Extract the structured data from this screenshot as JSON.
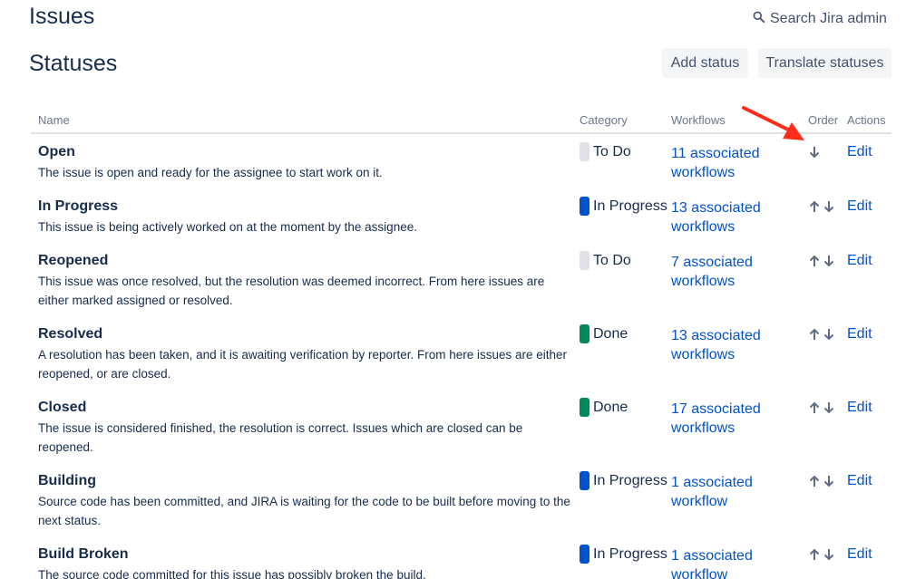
{
  "header": {
    "title": "Issues",
    "search_label": "Search Jira admin"
  },
  "section": {
    "title": "Statuses",
    "add_button": "Add status",
    "translate_button": "Translate statuses"
  },
  "table": {
    "columns": {
      "name": "Name",
      "category": "Category",
      "workflows": "Workflows",
      "order": "Order",
      "actions": "Actions"
    },
    "rows": [
      {
        "name": "Open",
        "description": "The issue is open and ready for the assignee to start work on it.",
        "category": "To Do",
        "category_color": "#dfe1e6",
        "workflows_line1": "11 associated",
        "workflows_line2": "workflows",
        "edit": "Edit"
      },
      {
        "name": "In Progress",
        "description": "This issue is being actively worked on at the moment by the assignee.",
        "category": "In Progress",
        "category_color": "#0052cc",
        "workflows_line1": "13 associated",
        "workflows_line2": "workflows",
        "edit": "Edit"
      },
      {
        "name": "Reopened",
        "description": "This issue was once resolved, but the resolution was deemed incorrect. From here issues are either marked assigned or resolved.",
        "category": "To Do",
        "category_color": "#dfe1e6",
        "workflows_line1": "7 associated",
        "workflows_line2": "workflows",
        "edit": "Edit"
      },
      {
        "name": "Resolved",
        "description": "A resolution has been taken, and it is awaiting verification by reporter. From here issues are either reopened, or are closed.",
        "category": "Done",
        "category_color": "#00875a",
        "workflows_line1": "13 associated",
        "workflows_line2": "workflows",
        "edit": "Edit"
      },
      {
        "name": "Closed",
        "description": "The issue is considered finished, the resolution is correct. Issues which are closed can be reopened.",
        "category": "Done",
        "category_color": "#00875a",
        "workflows_line1": "17 associated",
        "workflows_line2": "workflows",
        "edit": "Edit"
      },
      {
        "name": "Building",
        "description": "Source code has been committed, and JIRA is waiting for the code to be built before moving to the next status.",
        "category": "In Progress",
        "category_color": "#0052cc",
        "workflows_line1": "1 associated",
        "workflows_line2": "workflow",
        "edit": "Edit"
      },
      {
        "name": "Build Broken",
        "description": "The source code committed for this issue has possibly broken the build.",
        "category": "In Progress",
        "category_color": "#0052cc",
        "workflows_line1": "1 associated",
        "workflows_line2": "workflow",
        "edit": "Edit"
      }
    ]
  },
  "colors": {
    "link": "#0052cc",
    "text": "#172b4d",
    "annotation": "#ff2d1a"
  },
  "icons": {
    "search": "search-icon",
    "up": "arrow-up-icon",
    "down": "arrow-down-icon"
  }
}
